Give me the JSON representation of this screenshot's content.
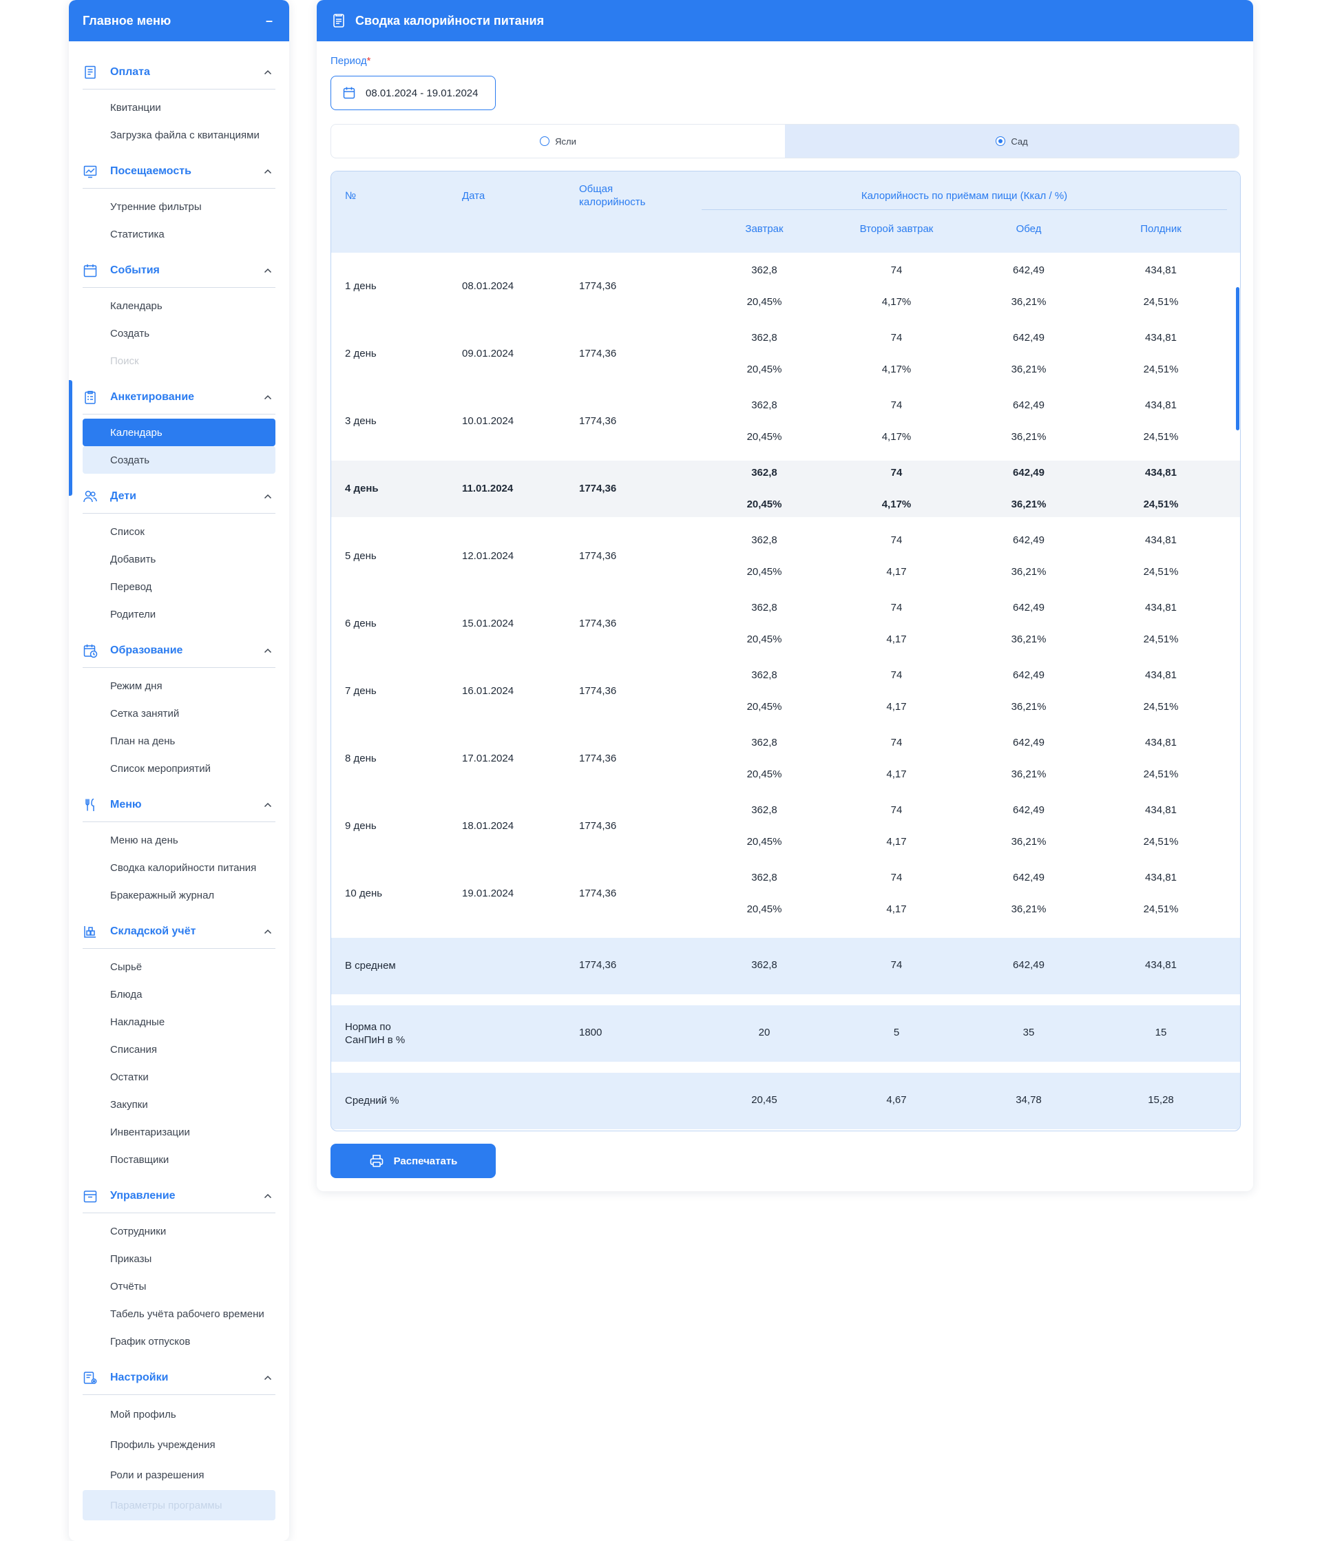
{
  "sidebar": {
    "title": "Главное меню",
    "collapse_symbol": "–",
    "groups": [
      {
        "title": "Оплата",
        "icon": "receipt-icon",
        "items": [
          {
            "label": "Квитанции"
          },
          {
            "label": "Загрузка файла с квитанциями"
          }
        ]
      },
      {
        "title": "Посещаемость",
        "icon": "chart-icon",
        "items": [
          {
            "label": "Утренние фильтры"
          },
          {
            "label": "Статистика"
          }
        ]
      },
      {
        "title": "События",
        "icon": "calendar-icon",
        "items": [
          {
            "label": "Календарь"
          },
          {
            "label": "Создать"
          },
          {
            "label": "Поиск",
            "state": "disabled"
          }
        ]
      },
      {
        "title": "Анкетирование",
        "icon": "clipboard-icon",
        "items": [
          {
            "label": "Календарь",
            "state": "active"
          },
          {
            "label": "Создать",
            "state": "hover"
          }
        ]
      },
      {
        "title": "Дети",
        "icon": "users-icon",
        "items": [
          {
            "label": "Список"
          },
          {
            "label": "Добавить"
          },
          {
            "label": "Перевод"
          },
          {
            "label": "Родители"
          }
        ]
      },
      {
        "title": "Образование",
        "icon": "schedule-icon",
        "items": [
          {
            "label": "Режим дня"
          },
          {
            "label": "Сетка занятий"
          },
          {
            "label": "План на день"
          },
          {
            "label": "Список мероприятий"
          }
        ]
      },
      {
        "title": "Меню",
        "icon": "cutlery-icon",
        "items": [
          {
            "label": "Меню на день"
          },
          {
            "label": "Сводка калорийности питания"
          },
          {
            "label": "Бракеражный журнал"
          }
        ]
      },
      {
        "title": "Складской учёт",
        "icon": "warehouse-icon",
        "items": [
          {
            "label": "Сырьё"
          },
          {
            "label": "Блюда"
          },
          {
            "label": "Накладные"
          },
          {
            "label": "Списания"
          },
          {
            "label": "Остатки"
          },
          {
            "label": "Закупки"
          },
          {
            "label": "Инвентаризации"
          },
          {
            "label": "Поставщики"
          }
        ]
      },
      {
        "title": "Управление",
        "icon": "briefcase-icon",
        "items": [
          {
            "label": "Сотрудники"
          },
          {
            "label": "Приказы"
          },
          {
            "label": "Отчёты"
          },
          {
            "label": "Табель учёта рабочего времени"
          },
          {
            "label": "График отпусков"
          }
        ]
      },
      {
        "title": "Настройки",
        "icon": "settings-icon",
        "items": [
          {
            "label": "Мой профиль"
          },
          {
            "label": "Профиль учреждения"
          },
          {
            "label": "Роли и разрешения"
          },
          {
            "label": "Параметры программы",
            "state": "disabled-hover"
          }
        ]
      }
    ]
  },
  "main": {
    "title": "Сводка калорийности питания",
    "period_label": "Период",
    "period_required": "*",
    "period_value": "08.01.2024 - 19.01.2024",
    "segments": [
      {
        "label": "Ясли",
        "selected": false
      },
      {
        "label": "Сад",
        "selected": true
      }
    ],
    "table": {
      "headers": {
        "num": "№",
        "date": "Дата",
        "total": "Общая калорийность",
        "group": "Калорийность по приёмам пищи (Ккал / %)",
        "breakfast": "Завтрак",
        "second_breakfast": "Второй завтрак",
        "lunch": "Обед",
        "snack": "Полдник"
      },
      "rows": [
        {
          "day": "1 день",
          "date": "08.01.2024",
          "total": "1774,36",
          "kcal": [
            "362,8",
            "74",
            "642,49",
            "434,81"
          ],
          "pct": [
            "20,45%",
            "4,17%",
            "36,21%",
            "24,51%"
          ]
        },
        {
          "day": "2 день",
          "date": "09.01.2024",
          "total": "1774,36",
          "kcal": [
            "362,8",
            "74",
            "642,49",
            "434,81"
          ],
          "pct": [
            "20,45%",
            "4,17%",
            "36,21%",
            "24,51%"
          ]
        },
        {
          "day": "3 день",
          "date": "10.01.2024",
          "total": "1774,36",
          "kcal": [
            "362,8",
            "74",
            "642,49",
            "434,81"
          ],
          "pct": [
            "20,45%",
            "4,17%",
            "36,21%",
            "24,51%"
          ]
        },
        {
          "day": "4 день",
          "date": "11.01.2024",
          "total": "1774,36",
          "kcal": [
            "362,8",
            "74",
            "642,49",
            "434,81"
          ],
          "pct": [
            "20,45%",
            "4,17%",
            "36,21%",
            "24,51%"
          ],
          "highlight": true
        },
        {
          "day": "5 день",
          "date": "12.01.2024",
          "total": "1774,36",
          "kcal": [
            "362,8",
            "74",
            "642,49",
            "434,81"
          ],
          "pct": [
            "20,45%",
            "4,17",
            "36,21%",
            "24,51%"
          ]
        },
        {
          "day": "6 день",
          "date": "15.01.2024",
          "total": "1774,36",
          "kcal": [
            "362,8",
            "74",
            "642,49",
            "434,81"
          ],
          "pct": [
            "20,45%",
            "4,17",
            "36,21%",
            "24,51%"
          ]
        },
        {
          "day": "7 день",
          "date": "16.01.2024",
          "total": "1774,36",
          "kcal": [
            "362,8",
            "74",
            "642,49",
            "434,81"
          ],
          "pct": [
            "20,45%",
            "4,17",
            "36,21%",
            "24,51%"
          ]
        },
        {
          "day": "8 день",
          "date": "17.01.2024",
          "total": "1774,36",
          "kcal": [
            "362,8",
            "74",
            "642,49",
            "434,81"
          ],
          "pct": [
            "20,45%",
            "4,17",
            "36,21%",
            "24,51%"
          ]
        },
        {
          "day": "9 день",
          "date": "18.01.2024",
          "total": "1774,36",
          "kcal": [
            "362,8",
            "74",
            "642,49",
            "434,81"
          ],
          "pct": [
            "20,45%",
            "4,17",
            "36,21%",
            "24,51%"
          ]
        },
        {
          "day": "10 день",
          "date": "19.01.2024",
          "total": "1774,36",
          "kcal": [
            "362,8",
            "74",
            "642,49",
            "434,81"
          ],
          "pct": [
            "20,45%",
            "4,17",
            "36,21%",
            "24,51%"
          ]
        }
      ],
      "summary": [
        {
          "label": "В среднем",
          "total": "1774,36",
          "vals": [
            "362,8",
            "74",
            "642,49",
            "434,81"
          ]
        },
        {
          "label": "Норма по СанПиН в %",
          "total": "1800",
          "vals": [
            "20",
            "5",
            "35",
            "15"
          ]
        },
        {
          "label": "Средний %",
          "total": "",
          "vals": [
            "20,45",
            "4,67",
            "34,78",
            "15,28"
          ]
        }
      ]
    },
    "print_label": "Распечатать"
  },
  "colors": {
    "accent": "#2b7cf0",
    "header_bg": "#e3eefc",
    "highlight_row": "#f2f4f7",
    "required": "#e53935"
  }
}
